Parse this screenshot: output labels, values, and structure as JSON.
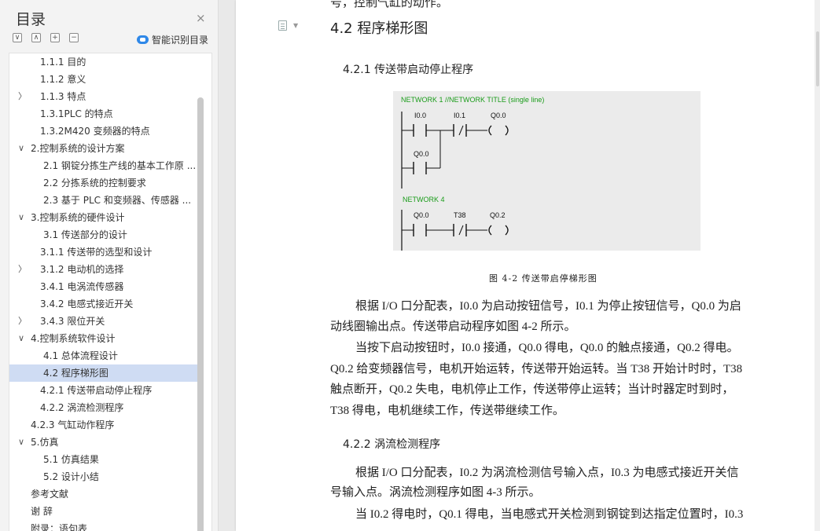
{
  "toc": {
    "title": "目录",
    "close_icon": "×",
    "smart_label": "智能识别目录",
    "items": [
      {
        "label": "1.1.1 目的",
        "indent": 50,
        "chev": ""
      },
      {
        "label": "1.1.2 意义",
        "indent": 50,
        "chev": ""
      },
      {
        "label": "1.1.3 特点",
        "indent": 50,
        "chev": "〉"
      },
      {
        "label": "1.3.1PLC 的特点",
        "indent": 50,
        "chev": ""
      },
      {
        "label": "1.3.2M420 变频器的特点",
        "indent": 50,
        "chev": ""
      },
      {
        "label": "2.控制系统的设计方案",
        "indent": 38,
        "chev": "∨"
      },
      {
        "label": "2.1 钢锭分拣生产线的基本工作原 ...",
        "indent": 54,
        "chev": ""
      },
      {
        "label": "2.2 分拣系统的控制要求",
        "indent": 54,
        "chev": ""
      },
      {
        "label": "2.3 基于 PLC 和变频器、传感器 ...",
        "indent": 54,
        "chev": ""
      },
      {
        "label": "3.控制系统的硬件设计",
        "indent": 38,
        "chev": "∨"
      },
      {
        "label": "3.1  传送部分的设计",
        "indent": 54,
        "chev": ""
      },
      {
        "label": "3.1.1 传送带的选型和设计",
        "indent": 50,
        "chev": ""
      },
      {
        "label": "3.1.2 电动机的选择",
        "indent": 50,
        "chev": "〉"
      },
      {
        "label": "3.4.1 电涡流传感器",
        "indent": 50,
        "chev": ""
      },
      {
        "label": "3.4.2 电感式接近开关",
        "indent": 50,
        "chev": ""
      },
      {
        "label": "3.4.3  限位开关",
        "indent": 50,
        "chev": "〉"
      },
      {
        "label": "4.控制系统软件设计",
        "indent": 38,
        "chev": "∨"
      },
      {
        "label": "4.1 总体流程设计",
        "indent": 54,
        "chev": ""
      },
      {
        "label": "4.2 程序梯形图",
        "indent": 54,
        "chev": "",
        "active": true
      },
      {
        "label": "4.2.1 传送带启动停止程序",
        "indent": 50,
        "chev": ""
      },
      {
        "label": "4.2.2 涡流检测程序",
        "indent": 50,
        "chev": ""
      },
      {
        "label": "4.2.3 气缸动作程序",
        "indent": 38,
        "chev": ""
      },
      {
        "label": "5.仿真",
        "indent": 38,
        "chev": "∨"
      },
      {
        "label": "5.1 仿真结果",
        "indent": 54,
        "chev": ""
      },
      {
        "label": "5.2 设计小结",
        "indent": 54,
        "chev": ""
      },
      {
        "label": "参考文献",
        "indent": 38,
        "chev": ""
      },
      {
        "label": "谢    辞",
        "indent": 38,
        "chev": ""
      },
      {
        "label": "附录：语句表",
        "indent": 38,
        "chev": ""
      }
    ]
  },
  "doc": {
    "top_fragment": "号，控制气缸的动作。",
    "heading_42": "4.2 程序梯形图",
    "heading_421": "4.2.1 传送带启动停止程序",
    "heading_422": "4.2.2 涡流检测程序",
    "ladder": {
      "network1_title": "NETWORK 1 //NETWORK TITLE (single line)",
      "network1_ops": [
        "I0.0",
        "I0.1",
        "Q0.0"
      ],
      "network1_branch": "Q0.0",
      "network4_title": "NETWORK 4",
      "network4_ops": [
        "Q0.0",
        "T38",
        "Q0.2"
      ]
    },
    "figure_caption": "图 4-2  传送带启停梯形图",
    "para1": [
      "根据 I/O 口分配表，I0.0 为启动按钮信号，I0.1 为停止按钮信号，Q0.0 为启",
      "动线圈输出点。传送带启动程序如图 4-2 所示。"
    ],
    "para2": [
      "当按下启动按钮时，I0.0 接通，Q0.0 得电，Q0.0 的触点接通，Q0.2 得电。",
      "Q0.2 给变频器信号，电机开始运转，传送带开始运转。当 T38 开始计时时，T38",
      "触点断开，Q0.2 失电，电机停止工作，传送带停止运转；当计时器定时到时，",
      "T38 得电，电机继续工作，传送带继续工作。"
    ],
    "para3": [
      "根据 I/O 口分配表，I0.2 为涡流检测信号输入点，I0.3 为电感式接近开关信",
      "号输入点。涡流检测程序如图 4-3 所示。"
    ],
    "para4": [
      "当 I0.2 得电时，Q0.1 得电，当电感式开关检测到钢锭到达指定位置时，I0.3"
    ]
  },
  "colors": {
    "network_title": "#1a9c1a",
    "toc_active": "#cfdcf3",
    "smart_icon": "#2f88e8"
  }
}
